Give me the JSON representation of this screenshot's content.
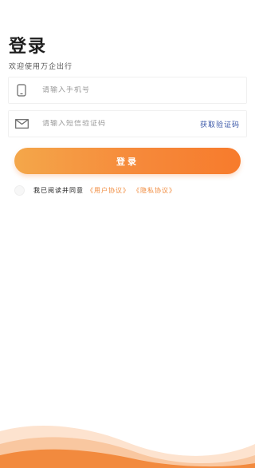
{
  "page": {
    "title": "登录",
    "subtitle": "欢迎使用万企出行"
  },
  "form": {
    "phone_placeholder": "请输入手机号",
    "code_placeholder": "请输入短信验证码",
    "get_code_label": "获取验证码",
    "phone_icon": "phone-icon",
    "mail_icon": "mail-icon"
  },
  "login_button": {
    "label": "登录"
  },
  "agreement": {
    "prefix": "我已阅读并同意",
    "user_agreement": "《用户协议》",
    "privacy_agreement": "《隐私协议》"
  },
  "colors": {
    "accent": "#f6893a",
    "link": "#3a57a8",
    "agreement_link": "#f08a3c"
  }
}
